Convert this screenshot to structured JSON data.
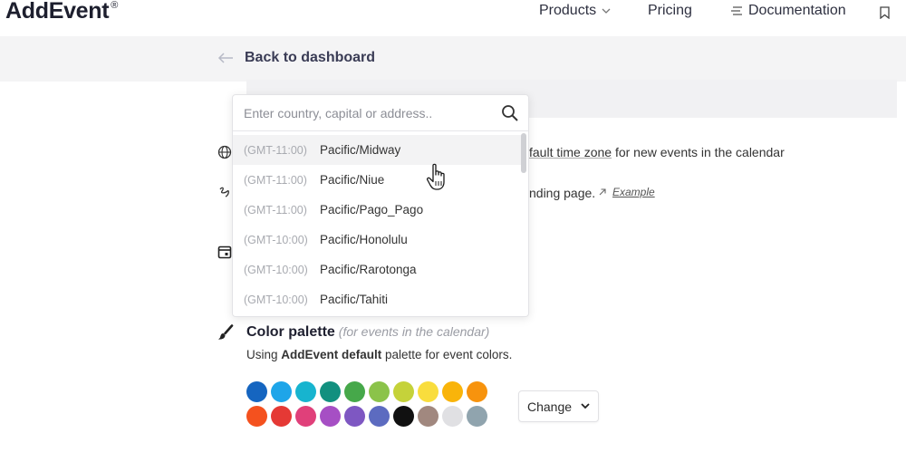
{
  "brand": {
    "name": "AddEvent",
    "mark": "®"
  },
  "nav": {
    "products": "Products",
    "pricing": "Pricing",
    "documentation": "Documentation"
  },
  "back": {
    "label": "Back to dashboard"
  },
  "behind": {
    "timezone_text_link": "fault time zone",
    "timezone_text_rest": " for new events in the calendar",
    "landing_text": "nding page.",
    "example_label": "Example"
  },
  "timezone_search": {
    "placeholder": "Enter country, capital or address..",
    "value": ""
  },
  "timezones": [
    {
      "offset": "(GMT-11:00)",
      "name": "Pacific/Midway"
    },
    {
      "offset": "(GMT-11:00)",
      "name": "Pacific/Niue"
    },
    {
      "offset": "(GMT-11:00)",
      "name": "Pacific/Pago_Pago"
    },
    {
      "offset": "(GMT-10:00)",
      "name": "Pacific/Honolulu"
    },
    {
      "offset": "(GMT-10:00)",
      "name": "Pacific/Rarotonga"
    },
    {
      "offset": "(GMT-10:00)",
      "name": "Pacific/Tahiti"
    }
  ],
  "color_palette": {
    "title": "Color palette",
    "subtitle": "(for events in the calendar)",
    "desc_pre": "Using ",
    "desc_bold": "AddEvent default",
    "desc_post": " palette for event colors.",
    "change_label": "Change",
    "swatches": [
      "#1565c0",
      "#1ea5e9",
      "#17b4cf",
      "#12907f",
      "#46a84a",
      "#8bc34a",
      "#c5d23a",
      "#f9dd3d",
      "#f9b40a",
      "#f7930d",
      "#f4511e",
      "#e53935",
      "#e0407a",
      "#a64fc4",
      "#7e57c2",
      "#5c6bc0",
      "#111111",
      "#a1887f",
      "#e0e0e3",
      "#90a4ae"
    ]
  }
}
